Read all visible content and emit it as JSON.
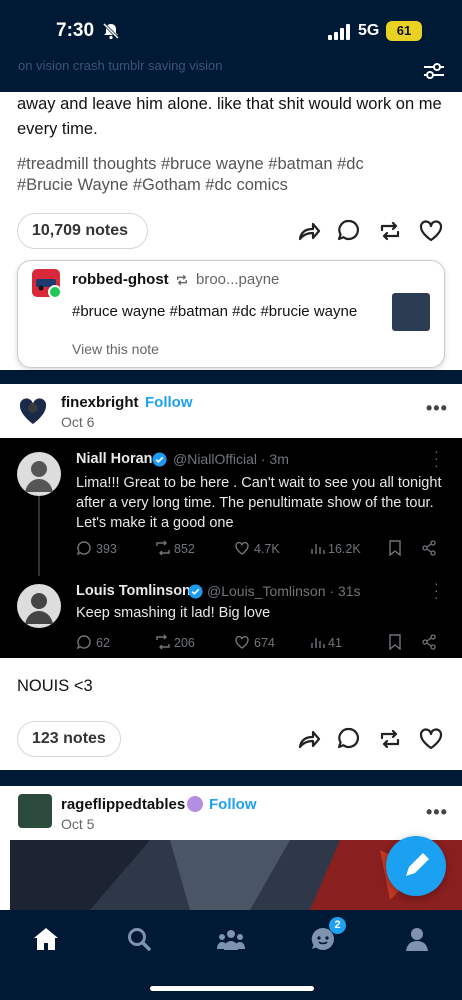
{
  "status_bar": {
    "time": "7:30",
    "network": "5G",
    "battery": "61",
    "faded_header": "on vision crash tumblr saving vision"
  },
  "post1": {
    "body": "away and leave him alone. like that shit would work on me every time.",
    "tags_line1": "#treadmill thoughts  #bruce wayne  #batman  #dc",
    "tags_line2": "#Brucie Wayne  #Gotham  #dc comics",
    "notes": "10,709 notes",
    "reblog_note": {
      "blog": "robbed-ghost",
      "via": "broo...payne",
      "tags": "#bruce wayne #batman #dc #brucie wayne",
      "view_label": "View this note"
    }
  },
  "post2": {
    "blog": "finexbright",
    "follow": "Follow",
    "date": "Oct 6",
    "tweet1": {
      "name": "Niall Horan",
      "handle": "@NiallOfficial · 3m",
      "text": "Lima!!! Great to be here . Can't wait to see you all tonight after a very long time. The penultimate show of the tour. Let's make it a good one",
      "replies": "393",
      "retweets": "852",
      "likes": "4.7K",
      "views": "16.2K"
    },
    "tweet2": {
      "name": "Louis Tomlinson",
      "handle": "@Louis_Tomlinson · 31s",
      "text": "Keep smashing it lad! Big love",
      "replies": "62",
      "retweets": "206",
      "likes": "674",
      "views": "41"
    },
    "caption": "NOUIS <3",
    "notes": "123 notes"
  },
  "post3": {
    "blog": "rageflippedtables",
    "follow": "Follow",
    "date": "Oct 5"
  },
  "nav": {
    "badge": "2"
  },
  "colors": {
    "navy": "#001935",
    "accent": "#1da1f2",
    "fab": "#1ba1f2",
    "battery": "#e9d223"
  }
}
